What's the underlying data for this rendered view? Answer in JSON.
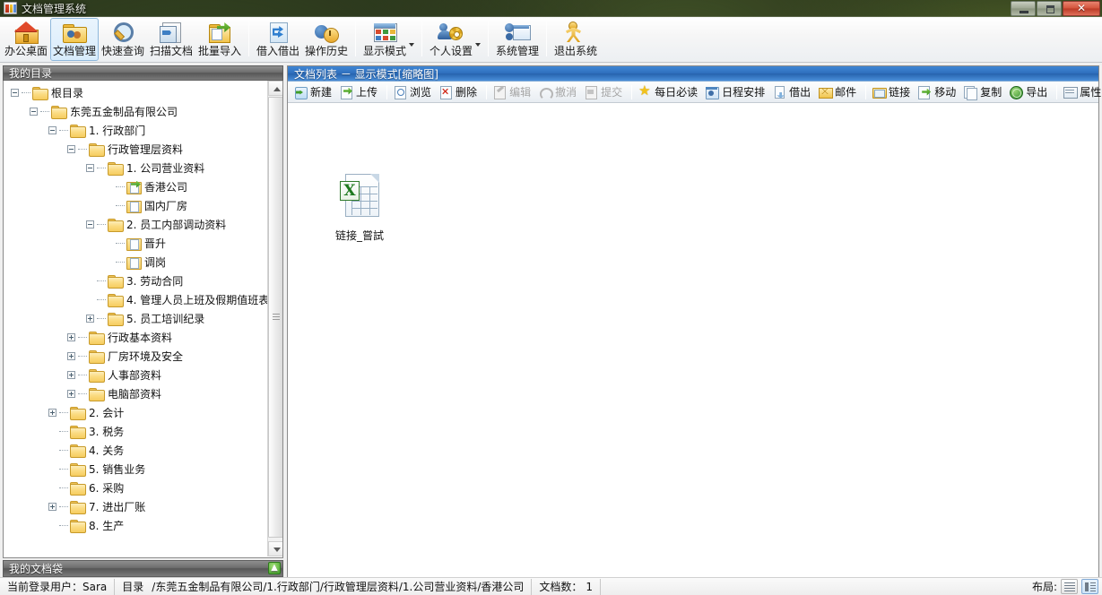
{
  "window": {
    "title": "文档管理系统",
    "icon": "app-icon",
    "buttons": {
      "minimize": "—",
      "maximize": "❐",
      "close": "✕"
    }
  },
  "main_toolbar": {
    "items": [
      {
        "label": "办公桌面",
        "icon": "home-icon",
        "selected": false,
        "dropdown": false
      },
      {
        "label": "文档管理",
        "icon": "folder-people-icon",
        "selected": true,
        "dropdown": false
      },
      {
        "label": "快速查询",
        "icon": "magnifier-icon",
        "selected": false,
        "dropdown": false
      },
      {
        "label": "扫描文档",
        "icon": "scanner-icon",
        "selected": false,
        "dropdown": false
      },
      {
        "label": "批量导入",
        "icon": "batch-import-icon",
        "selected": false,
        "dropdown": false
      },
      {
        "label": "借入借出",
        "icon": "lend-borrow-icon",
        "selected": false,
        "dropdown": false
      },
      {
        "label": "操作历史",
        "icon": "history-icon",
        "selected": false,
        "dropdown": false
      },
      {
        "label": "显示模式",
        "icon": "display-mode-icon",
        "selected": false,
        "dropdown": true
      },
      {
        "label": "个人设置",
        "icon": "personal-settings-icon",
        "selected": false,
        "dropdown": true
      },
      {
        "label": "系统管理",
        "icon": "system-admin-icon",
        "selected": false,
        "dropdown": false
      },
      {
        "label": "退出系统",
        "icon": "exit-icon",
        "selected": false,
        "dropdown": false
      }
    ]
  },
  "left_panel": {
    "caption": "我的目录",
    "docbag_caption": "我的文档袋",
    "docbag_button_icon": "up-arrow-icon",
    "tree": [
      {
        "label": "根目录",
        "depth": 0,
        "icon": "folder",
        "expander": "minus"
      },
      {
        "label": "东莞五金制品有限公司",
        "depth": 1,
        "icon": "folder",
        "expander": "minus"
      },
      {
        "label": "1. 行政部门",
        "depth": 2,
        "icon": "folder",
        "expander": "minus"
      },
      {
        "label": "行政管理层资料",
        "depth": 3,
        "icon": "folder",
        "expander": "minus"
      },
      {
        "label": "1. 公司营业资料",
        "depth": 4,
        "icon": "folder",
        "expander": "minus"
      },
      {
        "label": "香港公司",
        "depth": 5,
        "icon": "doc-arrow",
        "expander": "none"
      },
      {
        "label": "国内厂房",
        "depth": 5,
        "icon": "doc",
        "expander": "none"
      },
      {
        "label": "2. 员工内部调动资料",
        "depth": 4,
        "icon": "folder",
        "expander": "minus"
      },
      {
        "label": "晋升",
        "depth": 5,
        "icon": "doc",
        "expander": "none"
      },
      {
        "label": "调岗",
        "depth": 5,
        "icon": "doc",
        "expander": "none"
      },
      {
        "label": "3. 劳动合同",
        "depth": 4,
        "icon": "folder",
        "expander": "none"
      },
      {
        "label": "4. 管理人员上班及假期值班表",
        "depth": 4,
        "icon": "folder",
        "expander": "none"
      },
      {
        "label": "5. 员工培训纪录",
        "depth": 4,
        "icon": "folder",
        "expander": "plus"
      },
      {
        "label": "行政基本资料",
        "depth": 3,
        "icon": "folder",
        "expander": "plus"
      },
      {
        "label": "厂房环境及安全",
        "depth": 3,
        "icon": "folder",
        "expander": "plus"
      },
      {
        "label": "人事部资料",
        "depth": 3,
        "icon": "folder",
        "expander": "plus"
      },
      {
        "label": "电脑部资料",
        "depth": 3,
        "icon": "folder",
        "expander": "plus"
      },
      {
        "label": "2. 会计",
        "depth": 2,
        "icon": "folder",
        "expander": "plus"
      },
      {
        "label": "3. 税务",
        "depth": 2,
        "icon": "folder",
        "expander": "none"
      },
      {
        "label": "4. 关务",
        "depth": 2,
        "icon": "folder",
        "expander": "none"
      },
      {
        "label": "5. 销售业务",
        "depth": 2,
        "icon": "folder",
        "expander": "none"
      },
      {
        "label": "6. 采购",
        "depth": 2,
        "icon": "folder",
        "expander": "none"
      },
      {
        "label": "7. 进出厂账",
        "depth": 2,
        "icon": "folder",
        "expander": "plus"
      },
      {
        "label": "8. 生产",
        "depth": 2,
        "icon": "folder",
        "expander": "none"
      }
    ]
  },
  "right_panel": {
    "caption": "文档列表 －  显示模式[缩略图]",
    "toolbar": [
      {
        "label": "新建",
        "icon": "new-icon",
        "disabled": false,
        "sep_after": false
      },
      {
        "label": "上传",
        "icon": "upload-icon",
        "disabled": false,
        "sep_after": true
      },
      {
        "label": "浏览",
        "icon": "browse-icon",
        "disabled": false,
        "sep_after": false
      },
      {
        "label": "删除",
        "icon": "delete-icon",
        "disabled": false,
        "sep_after": true
      },
      {
        "label": "编辑",
        "icon": "edit-icon",
        "disabled": true,
        "sep_after": false
      },
      {
        "label": "撤消",
        "icon": "undo-icon",
        "disabled": true,
        "sep_after": false
      },
      {
        "label": "提交",
        "icon": "submit-icon",
        "disabled": true,
        "sep_after": true
      },
      {
        "label": "每日必读",
        "icon": "star-icon",
        "disabled": false,
        "sep_after": false
      },
      {
        "label": "日程安排",
        "icon": "calendar-icon",
        "disabled": false,
        "sep_after": false
      },
      {
        "label": "借出",
        "icon": "lend-icon",
        "disabled": false,
        "sep_after": false
      },
      {
        "label": "邮件",
        "icon": "mail-icon",
        "disabled": false,
        "sep_after": true
      },
      {
        "label": "链接",
        "icon": "link-icon",
        "disabled": false,
        "sep_after": false
      },
      {
        "label": "移动",
        "icon": "move-icon",
        "disabled": false,
        "sep_after": false
      },
      {
        "label": "复制",
        "icon": "copy-icon",
        "disabled": false,
        "sep_after": false
      },
      {
        "label": "导出",
        "icon": "export-icon",
        "disabled": false,
        "sep_after": true
      },
      {
        "label": "属性",
        "icon": "properties-icon",
        "disabled": false,
        "sep_after": false
      }
    ],
    "files": [
      {
        "name": "链接_嘗試",
        "icon": "excel-file-icon",
        "glyph": "X"
      }
    ]
  },
  "statusbar": {
    "user_label": "当前登录用户：Sara",
    "dir_label": "目录",
    "dir_path": "/东莞五金制品有限公司/1.行政部门/行政管理层资料/1.公司营业资料/香港公司",
    "count_label": "文档数：",
    "count_value": "1",
    "layout_label": "布局:",
    "layout_buttons": [
      {
        "icon": "list-layout-icon",
        "active": false
      },
      {
        "icon": "split-layout-icon",
        "active": true
      }
    ]
  },
  "theme": {
    "caption_blue": "#2f6fbd",
    "panel_gray": "#6e6e6e",
    "folder_yellow": "#f6cc5e",
    "accent_green": "#3f9e28"
  }
}
